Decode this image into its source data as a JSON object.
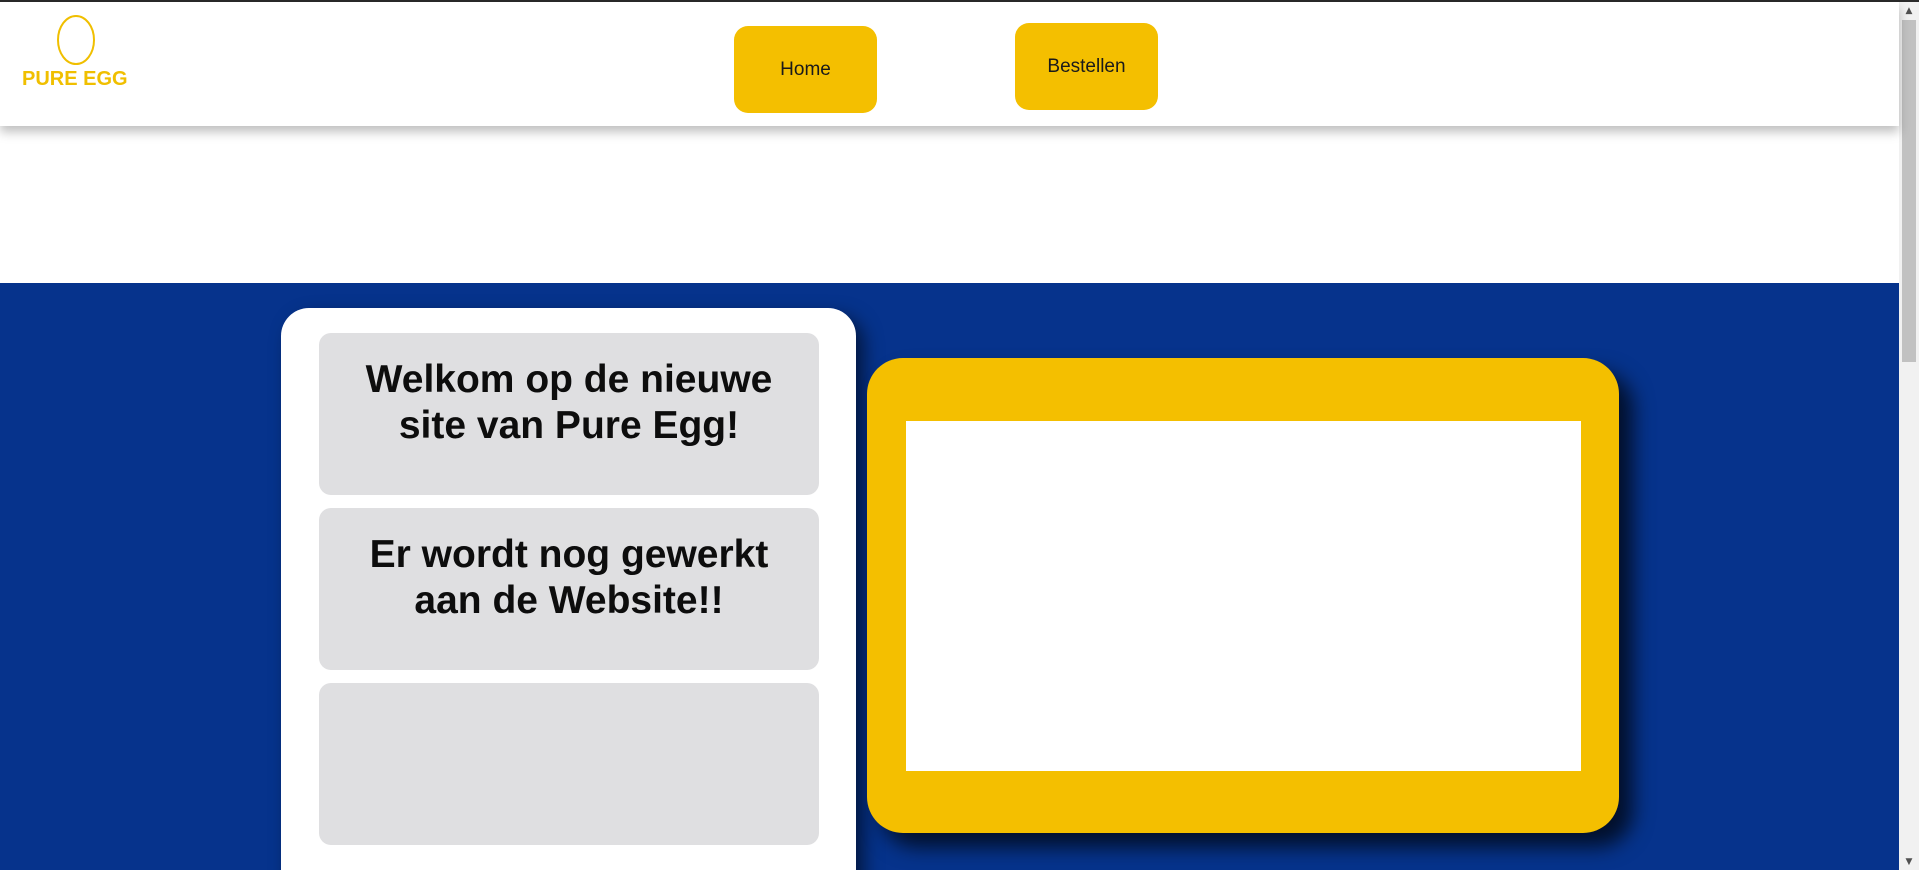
{
  "header": {
    "logo_text": "PURE EGG",
    "logo_icon": "egg-icon",
    "nav": {
      "home_label": "Home",
      "order_label": "Bestellen"
    }
  },
  "main": {
    "panels": [
      {
        "text": "Welkom op de nieuwe site van Pure Egg!"
      },
      {
        "text": "Er wordt nog gewerkt aan de Website!!"
      },
      {
        "text": ""
      }
    ]
  },
  "scrollbar": {
    "up_icon": "▲",
    "down_icon": "▼"
  },
  "colors": {
    "brand_yellow": "#f4bf00",
    "brand_blue": "#06338c",
    "panel_gray": "#dfdfe1"
  }
}
